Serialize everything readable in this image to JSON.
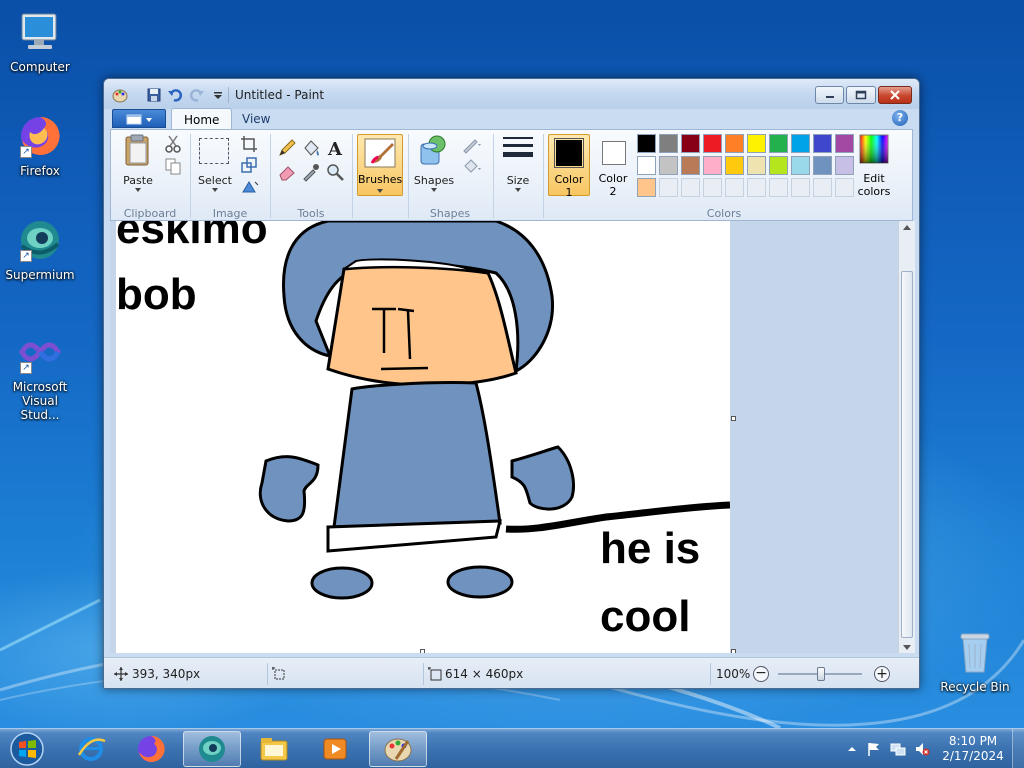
{
  "desktop": {
    "icons": [
      {
        "label": "Computer"
      },
      {
        "label": "Firefox"
      },
      {
        "label": "Supermium"
      },
      {
        "label_line1": "Microsoft",
        "label_line2": "Visual Stud..."
      },
      {
        "label": "Recycle Bin"
      }
    ]
  },
  "window": {
    "title": "Untitled - Paint",
    "tabs": [
      {
        "label": "Home"
      },
      {
        "label": "View"
      }
    ],
    "groups": {
      "clipboard": {
        "label": "Clipboard",
        "paste_label": "Paste"
      },
      "image": {
        "label": "Image",
        "select_label": "Select"
      },
      "tools": {
        "label": "Tools"
      },
      "brushes": {
        "label": "Brushes"
      },
      "shapes": {
        "label": "Shapes",
        "shapes_label": "Shapes"
      },
      "size": {
        "label": "Size"
      },
      "colors": {
        "label": "Colors",
        "color1_line1": "Color",
        "color1_line2": "1",
        "color2_line1": "Color",
        "color2_line2": "2",
        "edit_line1": "Edit",
        "edit_line2": "colors",
        "color1_value": "#000000",
        "color2_value": "#ffffff",
        "palette_row1": [
          "#000000",
          "#7f7f7f",
          "#880015",
          "#ed1c24",
          "#ff7f27",
          "#fff200",
          "#22b14c",
          "#00a2e8",
          "#3f48cc",
          "#a349a4"
        ],
        "palette_row2": [
          "#ffffff",
          "#c3c3c3",
          "#b97a57",
          "#ffaec9",
          "#ffc90e",
          "#efe4b0",
          "#b5e61d",
          "#99d9ea",
          "#7092be",
          "#c8bfe7"
        ],
        "palette_row3_first": "#ffc58a"
      }
    },
    "canvas": {
      "text_eskimo": "eskimo",
      "text_bob": "bob",
      "text_he_is": "he is",
      "text_cool": "cool",
      "body_color": "#7092be",
      "face_color": "#ffc58a"
    },
    "status": {
      "cursor_pos": "393, 340px",
      "image_size": "614 × 460px",
      "zoom": "100%"
    }
  },
  "taskbar": {
    "time": "8:10 PM",
    "date": "2/17/2024"
  }
}
